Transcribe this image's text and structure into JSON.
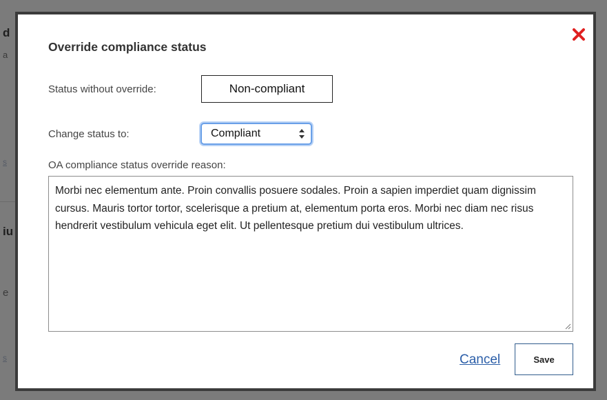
{
  "background": {
    "fragments": [
      "d",
      "a",
      "s",
      "iu",
      "e",
      "s"
    ]
  },
  "modal": {
    "title": "Override compliance status",
    "close_icon": "close-x-icon",
    "status_without_override_label": "Status without override:",
    "status_without_override_value": "Non-compliant",
    "change_status_label": "Change status to:",
    "change_status_selected": "Compliant",
    "reason_label": "OA compliance status override reason:",
    "reason_text": "Morbi nec elementum ante. Proin convallis posuere sodales. Proin a sapien imperdiet quam dignissim cursus. Mauris tortor tortor, scelerisque a pretium at, elementum porta eros. Morbi nec diam nec risus hendrerit vestibulum vehicula eget elit. Ut pellentesque pretium dui vestibulum ultrices.",
    "cancel_label": "Cancel",
    "save_label": "Save"
  },
  "colors": {
    "close_icon": "#e02020",
    "link": "#2b5ea8",
    "focus_ring": "#6aa0e8",
    "overlay": "#7b7b7b"
  }
}
